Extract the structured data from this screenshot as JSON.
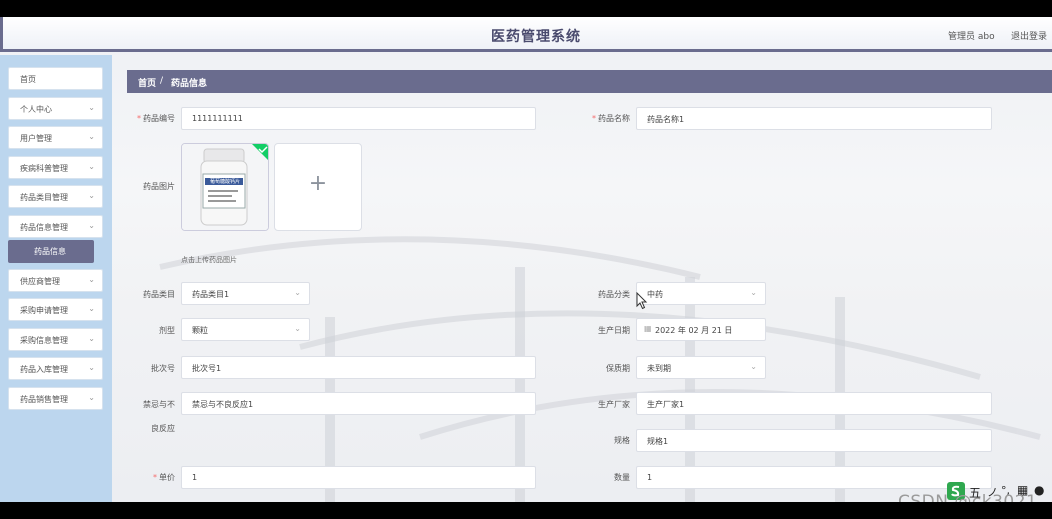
{
  "header": {
    "title": "医药管理系统",
    "user": "管理员 abo",
    "logout": "退出登录"
  },
  "sidebar": {
    "items": [
      {
        "label": "首页"
      },
      {
        "label": "个人中心",
        "chevron": "⌄"
      },
      {
        "label": "用户管理",
        "chevron": "⌄"
      },
      {
        "label": "疾病科普管理",
        "chevron": "⌄"
      },
      {
        "label": "药品类目管理",
        "chevron": "⌄"
      },
      {
        "label": "药品信息管理",
        "chevron": "⌄"
      },
      {
        "label": "供应商管理",
        "chevron": "⌄"
      },
      {
        "label": "采购申请管理",
        "chevron": "⌄"
      },
      {
        "label": "采购信息管理",
        "chevron": "⌄"
      },
      {
        "label": "药品入库管理",
        "chevron": "⌄"
      },
      {
        "label": "药品销售管理",
        "chevron": "⌄"
      }
    ],
    "active_sub": "药品信息"
  },
  "breadcrumb": {
    "home": "首页",
    "sep": "/",
    "current": "药品信息"
  },
  "form": {
    "code_label": "药品编号",
    "code_value": "1111111111",
    "name_label": "药品名称",
    "name_value": "药品名称1",
    "image_label": "药品图片",
    "upload_tip": "点击上传药品图片",
    "bottle_label": "葡萄糖酸钙片",
    "category_label": "药品类目",
    "category_value": "药品类目1",
    "type_label": "药品分类",
    "type_value": "中药",
    "form_label": "剂型",
    "form_value": "颗粒",
    "date_label": "生产日期",
    "date_value": "2022 年 02 月 21 日",
    "batch_label": "批次号",
    "batch_value": "批次号1",
    "expiry_label": "保质期",
    "expiry_value": "未到期",
    "contra_label_1": "禁忌与不",
    "contra_label_2": "良反应",
    "contra_value": "禁忌与不良反应1",
    "maker_label": "生产厂家",
    "maker_value": "生产厂家1",
    "spec_label": "规格",
    "spec_value": "规格1",
    "price_label": "单价",
    "price_value": "1",
    "qty_label": "数量",
    "qty_value": "1",
    "required_mark": "*",
    "chevron": "⌄",
    "calendar_icon": "▦",
    "plus": "+"
  },
  "watermark": "CSDN @ck3021",
  "ime_label": "五"
}
